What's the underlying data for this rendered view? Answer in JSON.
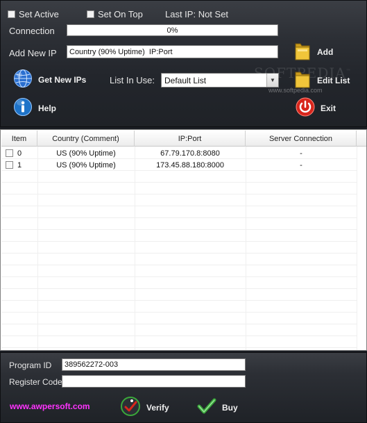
{
  "options": {
    "set_active": "Set Active",
    "set_on_top": "Set On Top",
    "last_ip": "Last IP: Not Set"
  },
  "connection": {
    "label": "Connection",
    "progress_text": "0%",
    "progress_value": 0
  },
  "add_ip": {
    "label": "Add New IP",
    "value": "Country (90% Uptime)  IP:Port",
    "button": "Add"
  },
  "toolbar": {
    "get_new_ips": "Get New IPs",
    "list_in_use_label": "List In Use:",
    "list_selected": "Default List",
    "edit_list": "Edit List",
    "help": "Help",
    "exit": "Exit"
  },
  "watermark": {
    "text": "SOFTPEDIA",
    "tm": "™",
    "url": "www.softpedia.com"
  },
  "table": {
    "headers": [
      "Item",
      "Country (Comment)",
      "IP:Port",
      "Server Connection"
    ],
    "rows": [
      {
        "item": "0",
        "country": "US (90% Uptime)",
        "ip": "67.79.170.8:8080",
        "server": "-"
      },
      {
        "item": "1",
        "country": "US (90% Uptime)",
        "ip": "173.45.88.180:8000",
        "server": "-"
      }
    ]
  },
  "registration": {
    "program_id_label": "Program ID",
    "program_id_value": "389562272-003",
    "register_code_label": "Register Code:",
    "register_code_value": ""
  },
  "footer": {
    "website": "www.awpersoft.com",
    "verify": "Verify",
    "buy": "Buy"
  },
  "colors": {
    "panel_bg": "#2c2f35",
    "link": "#ff33ff",
    "help_blue": "#1e73c8",
    "exit_red": "#d8261c",
    "verify_green": "#3aa83a"
  },
  "icons": [
    "globe-icon",
    "info-icon",
    "folder-icon",
    "power-icon",
    "run-check-icon",
    "checkmark-icon"
  ]
}
